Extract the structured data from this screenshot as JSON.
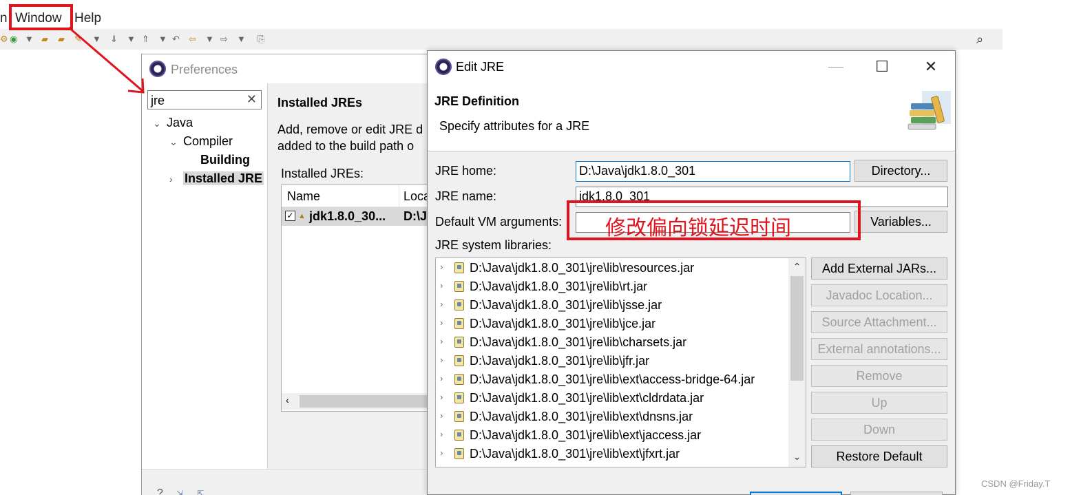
{
  "menu": {
    "partial_item": "n",
    "window": "Window",
    "help": "Help"
  },
  "preferences": {
    "title": "Preferences",
    "filter_value": "jre",
    "tree": [
      {
        "label": "Java"
      },
      {
        "label": "Compiler"
      },
      {
        "label": "Building"
      },
      {
        "label": "Installed JRE"
      }
    ],
    "heading": "Installed JREs",
    "description_line1": "Add, remove or edit JRE d",
    "description_line2": "added to the build path o",
    "installed_label": "Installed JREs:",
    "columns": {
      "name": "Name",
      "location": "Loca"
    },
    "row": {
      "name": "jdk1.8.0_30...",
      "location": "D:\\J",
      "checked": true
    }
  },
  "edit_jre": {
    "title": "Edit JRE",
    "header_title": "JRE Definition",
    "header_subtitle": "Specify attributes for a JRE",
    "jre_home_label": "JRE home:",
    "jre_home_value": "D:\\Java\\jdk1.8.0_301",
    "directory_button": "Directory...",
    "jre_name_label": "JRE name:",
    "jre_name_value": "jdk1.8.0_301",
    "vm_args_label": "Default VM arguments:",
    "vm_args_value": "",
    "variables_button": "Variables...",
    "libraries_label": "JRE system libraries:",
    "libraries": [
      "D:\\Java\\jdk1.8.0_301\\jre\\lib\\resources.jar",
      "D:\\Java\\jdk1.8.0_301\\jre\\lib\\rt.jar",
      "D:\\Java\\jdk1.8.0_301\\jre\\lib\\jsse.jar",
      "D:\\Java\\jdk1.8.0_301\\jre\\lib\\jce.jar",
      "D:\\Java\\jdk1.8.0_301\\jre\\lib\\charsets.jar",
      "D:\\Java\\jdk1.8.0_301\\jre\\lib\\jfr.jar",
      "D:\\Java\\jdk1.8.0_301\\jre\\lib\\ext\\access-bridge-64.jar",
      "D:\\Java\\jdk1.8.0_301\\jre\\lib\\ext\\cldrdata.jar",
      "D:\\Java\\jdk1.8.0_301\\jre\\lib\\ext\\dnsns.jar",
      "D:\\Java\\jdk1.8.0_301\\jre\\lib\\ext\\jaccess.jar",
      "D:\\Java\\jdk1.8.0_301\\jre\\lib\\ext\\jfxrt.jar"
    ],
    "buttons": {
      "add_external_jars": "Add External JARs...",
      "javadoc_location": "Javadoc Location...",
      "source_attachment": "Source Attachment...",
      "external_annotations": "External annotations...",
      "remove": "Remove",
      "up": "Up",
      "down": "Down",
      "restore_default": "Restore Default"
    },
    "window_controls": {
      "minimize": "—",
      "maximize": "☐",
      "close": "✕"
    }
  },
  "annotation": {
    "text": "修改偏向锁延迟时间",
    "color": "#e0141e"
  },
  "watermark": "CSDN @Friday.T"
}
